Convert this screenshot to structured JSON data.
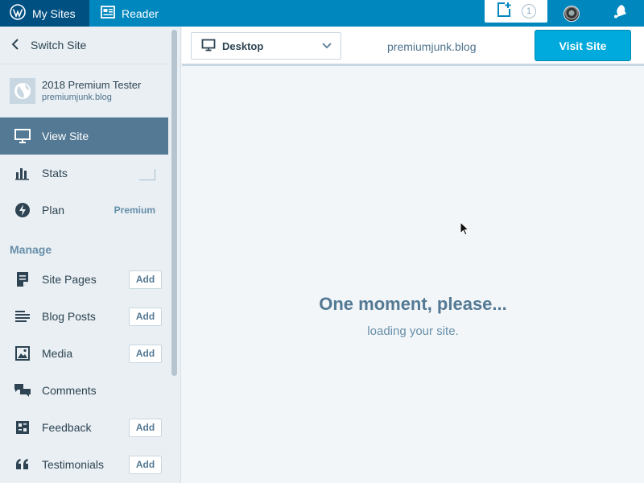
{
  "masterbar": {
    "my_sites_label": "My Sites",
    "reader_label": "Reader",
    "write_count": "1",
    "icons": [
      "wordpress-icon",
      "reader-icon",
      "write-post-icon",
      "avatar",
      "notifications-bell-icon"
    ]
  },
  "sidebar": {
    "switch_site_label": "Switch Site",
    "site": {
      "name": "2018 Premium Tester",
      "domain": "premiumjunk.blog"
    },
    "nav_top": [
      {
        "label": "View Site",
        "icon": "monitor-icon",
        "selected": true
      },
      {
        "label": "Stats",
        "icon": "stats-icon"
      },
      {
        "label": "Plan",
        "icon": "plan-icon",
        "badge": "Premium"
      }
    ],
    "manage_heading": "Manage",
    "manage_items": [
      {
        "label": "Site Pages",
        "icon": "pages-icon",
        "action": "Add"
      },
      {
        "label": "Blog Posts",
        "icon": "posts-icon",
        "action": "Add"
      },
      {
        "label": "Media",
        "icon": "media-icon",
        "action": "Add"
      },
      {
        "label": "Comments",
        "icon": "comments-icon"
      },
      {
        "label": "Feedback",
        "icon": "feedback-icon",
        "action": "Add"
      },
      {
        "label": "Testimonials",
        "icon": "testimonials-icon",
        "action": "Add"
      }
    ]
  },
  "preview": {
    "device_label": "Desktop",
    "url": "premiumjunk.blog",
    "visit_label": "Visit Site",
    "loading_title": "One moment, please...",
    "loading_sub": "loading your site."
  },
  "colors": {
    "masterbar": "#0087be",
    "masterbar_active": "#005082",
    "sidebar_bg": "#e9eff3",
    "selected_bg": "#537994",
    "primary_button": "#00aadc"
  }
}
